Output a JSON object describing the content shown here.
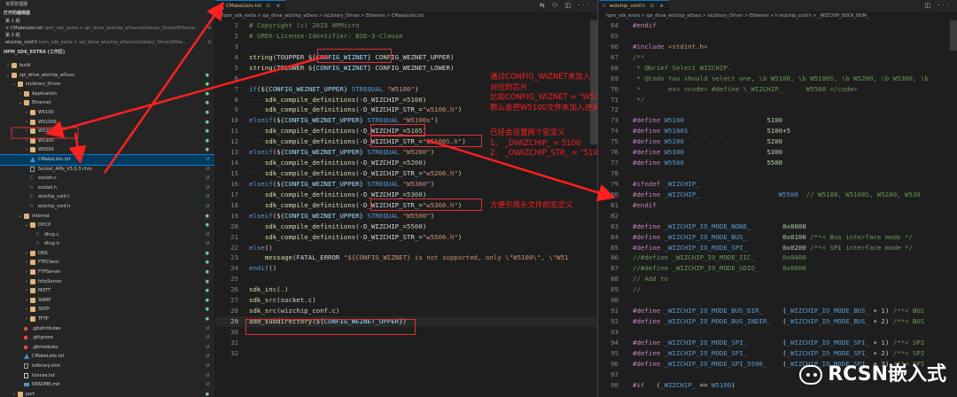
{
  "colors": {
    "accent": "#007acc",
    "annotation": "#e03131",
    "modified": "#e2c08d",
    "untracked": "#73c991"
  },
  "sidebar": {
    "title": "资源管理器",
    "open_editors_title": "打开的编辑器",
    "group1_title": "第 1 组",
    "group1_file": "CMakeLists.txt",
    "group1_path": "hpm_sdk_extra > spi_drive_wizchip_w5xxx\\ioLibrary_Driver\\Etherne...",
    "group1_badge": "U",
    "group2_title": "第 2 组",
    "group2_file": "wizchip_conf.h",
    "group2_path": "hpm_sdk_extra > spi_drive_wizchip_w5xxx\\ioLibrary_Driver\\Ethe...",
    "group2_badge": "U",
    "workspace_title": "HPM_SDK_EXTRA (工作区)",
    "tree": [
      {
        "label": "build",
        "type": "folder",
        "depth": 1,
        "arrow": ">",
        "badge": ""
      },
      {
        "label": "spi_drive_wizchip_w5xxx",
        "type": "folder",
        "depth": 1,
        "arrow": "v",
        "badge": "●"
      },
      {
        "label": "ioLibrary_Driver",
        "type": "folder",
        "depth": 2,
        "arrow": "v",
        "badge": "●"
      },
      {
        "label": "Application",
        "type": "folder",
        "depth": 3,
        "arrow": ">",
        "badge": "●"
      },
      {
        "label": "Ethernet",
        "type": "folder",
        "depth": 3,
        "arrow": "v",
        "badge": "●"
      },
      {
        "label": "W5100",
        "type": "folder",
        "depth": 4,
        "arrow": ">",
        "badge": "●"
      },
      {
        "label": "W5100S",
        "type": "folder",
        "depth": 4,
        "arrow": ">",
        "badge": "●"
      },
      {
        "label": "W5200",
        "type": "folder",
        "depth": 4,
        "arrow": ">",
        "badge": "●"
      },
      {
        "label": "W5300",
        "type": "folder",
        "depth": 4,
        "arrow": ">",
        "badge": "●"
      },
      {
        "label": "W5500",
        "type": "folder",
        "depth": 4,
        "arrow": ">",
        "badge": "●"
      },
      {
        "label": "CMakeLists.txt",
        "type": "cmake",
        "depth": 4,
        "arrow": "",
        "badge": "U",
        "selected": true
      },
      {
        "label": "Socket_APIs_V3.0.3.chm",
        "type": "file",
        "depth": 4,
        "arrow": "",
        "badge": "U"
      },
      {
        "label": "socket.c",
        "type": "c",
        "depth": 4,
        "arrow": "",
        "badge": "U"
      },
      {
        "label": "socket.h",
        "type": "h",
        "depth": 4,
        "arrow": "",
        "badge": "U"
      },
      {
        "label": "wizchip_conf.c",
        "type": "c",
        "depth": 4,
        "arrow": "",
        "badge": "U"
      },
      {
        "label": "wizchip_conf.h",
        "type": "h",
        "depth": 4,
        "arrow": "",
        "badge": "U"
      },
      {
        "label": "Internet",
        "type": "folder",
        "depth": 3,
        "arrow": "v",
        "badge": "●"
      },
      {
        "label": "DHCP",
        "type": "folder",
        "depth": 4,
        "arrow": "v",
        "badge": "●"
      },
      {
        "label": "dhcp.c",
        "type": "c",
        "depth": 5,
        "arrow": "",
        "badge": "U"
      },
      {
        "label": "dhcp.h",
        "type": "h",
        "depth": 5,
        "arrow": "",
        "badge": "U"
      },
      {
        "label": "DNS",
        "type": "folder",
        "depth": 4,
        "arrow": ">",
        "badge": "●"
      },
      {
        "label": "FTPClient",
        "type": "folder",
        "depth": 4,
        "arrow": ">",
        "badge": "●"
      },
      {
        "label": "FTPServer",
        "type": "folder",
        "depth": 4,
        "arrow": ">",
        "badge": "●"
      },
      {
        "label": "httpServer",
        "type": "folder",
        "depth": 4,
        "arrow": ">",
        "badge": "●"
      },
      {
        "label": "MQTT",
        "type": "folder",
        "depth": 4,
        "arrow": ">",
        "badge": "●"
      },
      {
        "label": "SNMP",
        "type": "folder",
        "depth": 4,
        "arrow": ">",
        "badge": "●"
      },
      {
        "label": "SNTP",
        "type": "folder",
        "depth": 4,
        "arrow": ">",
        "badge": "●"
      },
      {
        "label": "TFTP",
        "type": "folder",
        "depth": 4,
        "arrow": ">",
        "badge": "●"
      },
      {
        "label": ".gitattributes",
        "type": "git",
        "depth": 3,
        "arrow": "",
        "badge": "U"
      },
      {
        "label": ".gitignore",
        "type": "git",
        "depth": 3,
        "arrow": "",
        "badge": "U"
      },
      {
        "label": ".gitmodules",
        "type": "git",
        "depth": 3,
        "arrow": "",
        "badge": "U"
      },
      {
        "label": "CMakeLists.txt",
        "type": "cmake",
        "depth": 3,
        "arrow": "",
        "badge": "U"
      },
      {
        "label": "iolibrary.chm",
        "type": "file",
        "depth": 3,
        "arrow": "",
        "badge": "U"
      },
      {
        "label": "license.txt",
        "type": "txt",
        "depth": 3,
        "arrow": "",
        "badge": "U"
      },
      {
        "label": "README.md",
        "type": "md",
        "depth": 3,
        "arrow": "",
        "badge": "U"
      },
      {
        "label": "port",
        "type": "folder",
        "depth": 2,
        "arrow": ">",
        "badge": "●"
      }
    ]
  },
  "editor1": {
    "tab_label": "CMakeLists.txt",
    "tab_badge": "U",
    "tab_close": "×",
    "actions": "⇆ ⚇ ◫ ···",
    "breadcrumb": "hpm_sdk_extra > spi_drive_wizchip_w5xxx > ioLibrary_Driver > Ethernet > CMakeLists.txt",
    "lines": [
      {
        "n": "1",
        "html": "<span class='c'># Copyright (c) 2023 HPMicro</span>"
      },
      {
        "n": "2",
        "html": "<span class='c'># SPDX-License-Identifier: BSD-3-Clause</span>"
      },
      {
        "n": "3",
        "html": ""
      },
      {
        "n": "4",
        "html": "<span class='f'>string</span>(TOUPPER ${<span class='v'>CONFIG_WIZNET</span>} CONFIG_WEZNET_UPPER)"
      },
      {
        "n": "5",
        "html": "<span class='f'>string</span>(TOLOWER ${<span class='v'>CONFIG_WIZNET</span>} CONFIG_WEZNET_LOWER)"
      },
      {
        "n": "6",
        "html": ""
      },
      {
        "n": "7",
        "html": "<span class='k'>if</span>(${<span class='v'>CONFIG_WEZNET_UPPER</span>} <span class='k'>STREQUAL</span> <span class='s'>\"W5100\"</span>)"
      },
      {
        "n": "8",
        "html": "<span class='ws'>····</span><span class='f'>sdk_compile_definitions</span>(-D_WIZCHIP_=<span class='n'>5100</span>)"
      },
      {
        "n": "9",
        "html": "<span class='ws'>····</span><span class='f'>sdk_compile_definitions</span>(-D_WIZCHIP_STR_=<span class='s'>\"w5100.h\"</span>)"
      },
      {
        "n": "10",
        "html": "<span class='k'>elseif</span>(${<span class='v'>CONFIG_WEZNET_UPPER</span>} <span class='k'>STREQUAL</span> <span class='s'>\"W5100s\"</span>)"
      },
      {
        "n": "11",
        "html": "<span class='ws'>····</span><span class='f'>sdk_compile_definitions</span>(-D_WIZCHIP_=<span class='n'>5105</span>)"
      },
      {
        "n": "12",
        "html": "<span class='ws'>····</span><span class='f'>sdk_compile_definitions</span>(-D_WIZCHIP_STR_=<span class='s'>\"w5100S.h\"</span>)"
      },
      {
        "n": "13",
        "html": "<span class='k'>elseif</span>(${<span class='v'>CONFIG_WEZNET_UPPER</span>} <span class='k'>STREQUAL</span> <span class='s'>\"W5200\"</span>)"
      },
      {
        "n": "14",
        "html": "<span class='ws'>····</span><span class='f'>sdk_compile_definitions</span>(-D_WIZCHIP_=<span class='n'>5200</span>)"
      },
      {
        "n": "15",
        "html": "<span class='ws'>····</span><span class='f'>sdk_compile_definitions</span>(-D_WIZCHIP_STR_=<span class='s'>\"w5200.h\"</span>)"
      },
      {
        "n": "16",
        "html": "<span class='k'>elseif</span>(${<span class='v'>CONFIG_WEZNET_UPPER</span>} <span class='k'>STREQUAL</span> <span class='s'>\"W5300\"</span>)"
      },
      {
        "n": "17",
        "html": "<span class='ws'>····</span><span class='f'>sdk_compile_definitions</span>(-D_WIZCHIP_=<span class='n'>5300</span>)"
      },
      {
        "n": "18",
        "html": "<span class='ws'>····</span><span class='f'>sdk_compile_definitions</span>(-D_WIZCHIP_STR_=<span class='s'>\"w5300.h\"</span>)"
      },
      {
        "n": "19",
        "html": "<span class='k'>elseif</span>(${<span class='v'>CONFIG_WEZNET_UPPER</span>} <span class='k'>STREQUAL</span> <span class='s'>\"W5500\"</span>)"
      },
      {
        "n": "20",
        "html": "<span class='ws'>····</span><span class='f'>sdk_compile_definitions</span>(-D_WIZCHIP_=<span class='n'>5500</span>)"
      },
      {
        "n": "21",
        "html": "<span class='ws'>····</span><span class='f'>sdk_compile_definitions</span>(-D_WIZCHIP_STR_=<span class='s'>\"w5500.h\"</span>)"
      },
      {
        "n": "22",
        "html": "<span class='k'>else</span>()"
      },
      {
        "n": "23",
        "html": "<span class='ws'>····</span><span class='f'>message</span>(FATAL_ERROR <span class='s'>\"${CONFIG_WIZNET} is not supported, only \\\"W5100\\\", \\\"W51</span>"
      },
      {
        "n": "24",
        "html": "<span class='k'>endif</span>()"
      },
      {
        "n": "25",
        "html": ""
      },
      {
        "n": "26",
        "html": "<span class='f'>sdk_inc</span>(.)"
      },
      {
        "n": "27",
        "html": "<span class='f'>sdk_src</span>(socket.c)"
      },
      {
        "n": "28",
        "html": "<span class='f'>sdk_src</span>(wizchip_conf.c)"
      },
      {
        "n": "29",
        "html": "<span class='f'>add_subdirectory</span>(${<span class='v'>CONFIG_WEZNET_UPPER</span>})"
      },
      {
        "n": "30",
        "html": ""
      },
      {
        "n": "31",
        "html": ""
      },
      {
        "n": "32",
        "html": ""
      }
    ]
  },
  "editor2": {
    "tab_label": "wizchip_conf.h",
    "tab_badge": "U",
    "tab_close": "×",
    "actions": "◫ ···",
    "breadcrumb": "hpm_sdk_extra > spi_drive_wizchip_w5xxx > ioLibrary_Driver > Ethernet > h wizchip_conf.h > _WIZCHIP_SOCK_NUM_",
    "lines": [
      {
        "n": "64",
        "html": "<span class='p'>#endif</span>"
      },
      {
        "n": "65",
        "html": ""
      },
      {
        "n": "66",
        "html": "<span class='p'>#include</span> <span class='s'>&lt;stdint.h&gt;</span>"
      },
      {
        "n": "67",
        "html": "<span class='c'>/**</span>"
      },
      {
        "n": "68",
        "html": "<span class='c'> * @brief Select WIZCHIP.</span>"
      },
      {
        "n": "69",
        "html": "<span class='c'> * @todo You should select one, \\b W5100, \\b W5100S, \\b W5200, \\b W5300, \\b</span>"
      },
      {
        "n": "70",
        "html": "<span class='c'> *       ex> &lt;code&gt; #define \\_WIZCHIP_      W5500 &lt;/code&gt;</span>"
      },
      {
        "n": "71",
        "html": "<span class='c'> */</span>"
      },
      {
        "n": "72",
        "html": ""
      },
      {
        "n": "73",
        "html": "<span class='p'>#define</span> <span class='k'>W5100</span>  <span class='ws'>→   →   →   →   →</span>  <span class='n'>5100</span>"
      },
      {
        "n": "74",
        "html": "<span class='p'>#define</span> <span class='k'>W5100S</span> <span class='ws'>→   →   →   →   →</span>  <span class='n'>5100</span>+<span class='n'>5</span>"
      },
      {
        "n": "75",
        "html": "<span class='p'>#define</span> <span class='k'>W5200</span>  <span class='ws'>→   →   →   →   →</span>  <span class='n'>5200</span>"
      },
      {
        "n": "76",
        "html": "<span class='p'>#define</span> <span class='k'>W5300</span>  <span class='ws'>→   →   →   →   →</span>  <span class='n'>5300</span>"
      },
      {
        "n": "77",
        "html": "<span class='p'>#define</span> <span class='k'>W5500</span>  <span class='ws'>→   →   →   →   →</span>  <span class='n'>5500</span>"
      },
      {
        "n": "78",
        "html": ""
      },
      {
        "n": "79",
        "html": "<span class='p'>#ifndef</span> <span class='k'>_WIZCHIP_</span>"
      },
      {
        "n": "80",
        "html": "<span class='p'>#define</span> <span class='k'>_WIZCHIP_</span>                    <span class='k'>W5500</span>  <span class='c'>// W5100, W5100S, W5200, W530</span>"
      },
      {
        "n": "81",
        "html": "<span class='p'>#endif</span>"
      },
      {
        "n": "82",
        "html": ""
      },
      {
        "n": "83",
        "html": "<span class='p'>#define</span> <span class='k'>_WIZCHIP_IO_MODE_NONE_</span>        <span class='n'>0x0000</span>"
      },
      {
        "n": "84",
        "html": "<span class='p'>#define</span> <span class='k'>_WIZCHIP_IO_MODE_BUS_</span>         <span class='n'>0x0100</span> <span class='c'>/**&lt; Bus interface mode */</span>"
      },
      {
        "n": "85",
        "html": "<span class='p'>#define</span> <span class='k'>_WIZCHIP_IO_MODE_SPI_</span>         <span class='n'>0x0200</span> <span class='c'>/**&lt; SPI interface mode */</span>"
      },
      {
        "n": "86",
        "html": "<span class='c'>//#define _WIZCHIP_IO_MODE_IIC_       0x0400</span>"
      },
      {
        "n": "87",
        "html": "<span class='c'>//#define _WIZCHIP_IO_MODE_SDIO_      0x0800</span>"
      },
      {
        "n": "88",
        "html": "<span class='c'>// Add to</span>"
      },
      {
        "n": "89",
        "html": "<span class='c'>//</span>"
      },
      {
        "n": "90",
        "html": ""
      },
      {
        "n": "91",
        "html": "<span class='p'>#define</span> <span class='k'>_WIZCHIP_IO_MODE_BUS_DIR_</span>     (<span class='k'>_WIZCHIP_IO_MODE_BUS_</span> + <span class='n'>1</span>) <span class='c'>/**&lt; BUS</span>"
      },
      {
        "n": "92",
        "html": "<span class='p'>#define</span> <span class='k'>_WIZCHIP_IO_MODE_BUS_INDIR_</span>   (<span class='k'>_WIZCHIP_IO_MODE_BUS_</span> + <span class='n'>2</span>) <span class='c'>/**&lt; BUS</span>"
      },
      {
        "n": "93",
        "html": ""
      },
      {
        "n": "94",
        "html": "<span class='p'>#define</span> <span class='k'>_WIZCHIP_IO_MODE_SPI_</span>         (<span class='k'>_WIZCHIP_IO_MODE_SPI_</span> + <span class='n'>1</span>) <span class='c'>/**&lt; SPI</span>"
      },
      {
        "n": "95",
        "html": "<span class='p'>#define</span> <span class='k'>_WIZCHIP_IO_MODE_SPI_</span>         (<span class='k'>_WIZCHIP_IO_MODE_SPI_</span> + <span class='n'>2</span>) <span class='c'>/**&lt; SPI</span>"
      },
      {
        "n": "96",
        "html": "<span class='p'>#define</span> <span class='k'>_WIZCHIP_IO_MODE_SPI_5500_</span>    (<span class='k'>_WIZCHIP_IO_MODE_SPI_</span> + <span class='n'>3</span>) <span class='c'>/**&lt; SPI</span>"
      },
      {
        "n": "97",
        "html": ""
      },
      {
        "n": "98",
        "html": "<span class='p'>#if</span>   (<span class='k'>_WIZCHIP_</span> == <span class='k'>W5100</span>)"
      }
    ]
  },
  "annotations": {
    "note1": [
      "通过CONFIG_WIZNET来加入",
      "对应的芯片",
      "比如CONFIG_WIZNET = \"W5100\"",
      "那么会把W5100文件夹加入进来"
    ],
    "note2": [
      "已经会设置两个宏定义",
      "1、 _DWIZCHIP_ = 5100",
      "2、 _DWIZCHIP_STR_ = \"5100\""
    ],
    "note3": "方便引用头文件的宏定义"
  },
  "watermark": "RCSN嵌入式"
}
